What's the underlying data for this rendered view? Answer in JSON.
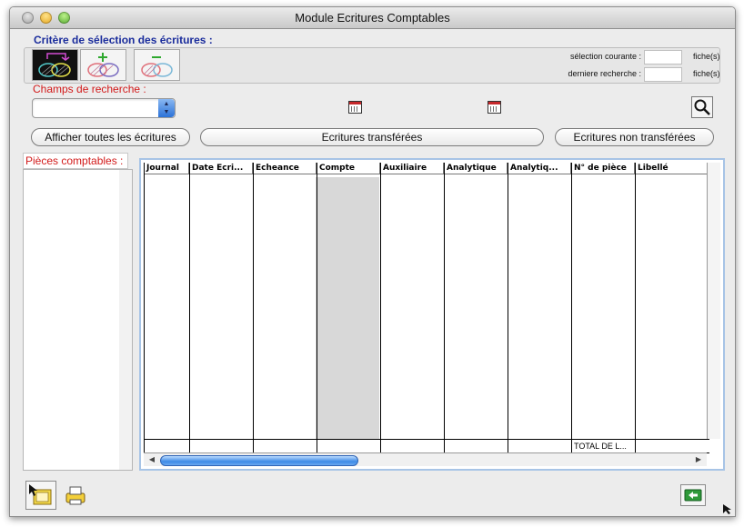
{
  "window": {
    "title": "Module Ecritures Comptables"
  },
  "criteria": {
    "title": "Critère de sélection des écritures :",
    "selection_label": "sélection courante :",
    "last_search_label": "derniere recherche :",
    "unit1": "fiche(s)",
    "unit2": "fiche(s)"
  },
  "search": {
    "label": "Champs de recherche :"
  },
  "buttons": {
    "show_all": "Afficher toutes les écritures",
    "transferred": "Ecritures transférées",
    "not_transferred": "Ecritures non transférées"
  },
  "pieces": {
    "label": "Pièces comptables :"
  },
  "table": {
    "columns": [
      "Journal",
      "Date Ecri...",
      "Echeance",
      "Compte",
      "Auxiliaire",
      "Analytique",
      "Analytiq...",
      "N° de pièce",
      "Libellé"
    ],
    "footer_total": "TOTAL DE L..."
  },
  "colors": {
    "accent_blue": "#1a2c9c",
    "label_red": "#d21a1a",
    "scroll_blue": "#3d8ae6"
  }
}
